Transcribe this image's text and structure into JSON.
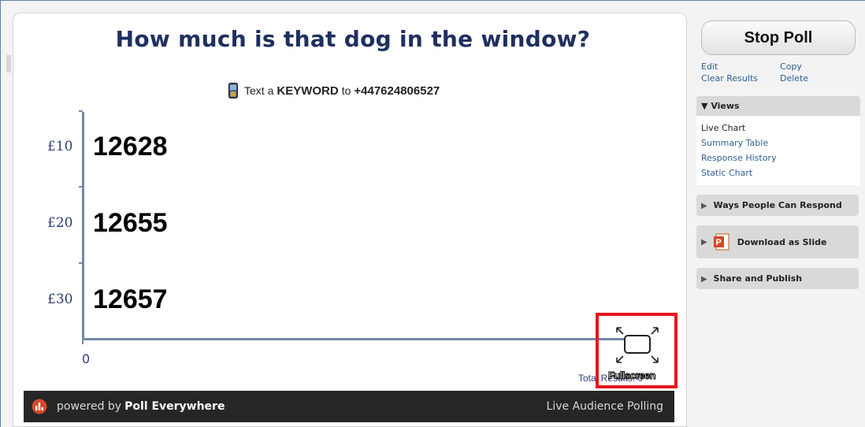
{
  "poll": {
    "title": "How much is that dog in the window?",
    "instructions": {
      "prefix": "Text a",
      "keyword": "KEYWORD",
      "middle": "to",
      "phone": "+447624806527"
    },
    "total_results_label": "Total Results: 0",
    "fullscreen_label": "Fullscreen"
  },
  "chart_data": {
    "type": "bar",
    "orientation": "horizontal",
    "categories": [
      "£10",
      "£20",
      "£30"
    ],
    "data_labels": [
      "12628",
      "12655",
      "12657"
    ],
    "values": [
      0,
      0,
      0
    ],
    "xlim_label": "0"
  },
  "footer": {
    "powered_by": "powered by",
    "brand": "Poll Everywhere",
    "tagline": "Live Audience Polling"
  },
  "sidebar": {
    "stop_button": "Stop Poll",
    "actions": {
      "edit": "Edit",
      "copy": "Copy",
      "clear": "Clear Results",
      "delete": "Delete"
    },
    "views": {
      "header": "Views",
      "current": "Live Chart",
      "links": [
        "Summary Table",
        "Response History",
        "Static Chart"
      ]
    },
    "ways_respond": "Ways People Can Respond",
    "download": "Download as Slide",
    "share": "Share and Publish"
  },
  "colors": {
    "title": "#1f2f60",
    "axis": "#7688aa",
    "link": "#2f5f93",
    "highlight": "#e6151b",
    "footer": "#262626"
  }
}
